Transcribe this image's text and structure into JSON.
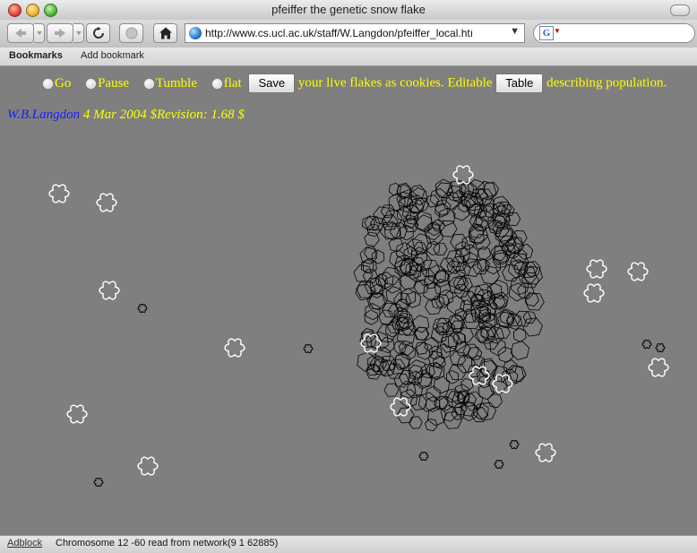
{
  "window": {
    "title": "pfeiffer the genetic snow flake"
  },
  "toolbar": {
    "url": "http://www.cs.ucl.ac.uk/staff/W.Langdon/pfeiffer_local.htı",
    "search_value": ""
  },
  "bookmarks_bar": {
    "bookmarks_label": "Bookmarks",
    "add_bookmark_label": "Add bookmark"
  },
  "controls": {
    "go_label": "Go",
    "pause_label": "Pause",
    "tumble_label": "Tumble",
    "flat_label": "flat",
    "save_button": "Save",
    "save_suffix": "your live flakes as cookies. Editable",
    "table_button": "Table",
    "table_suffix": "describing population."
  },
  "byline": {
    "author": "W.B.Langdon",
    "date_revision": "4 Mar 2004 $Revision: 1.68 $"
  },
  "status": {
    "adblock_label": "Adblock",
    "message": "Chromosome 12 -60 read from network(9 1 62885)"
  },
  "colors": {
    "background": "#7f7f7f",
    "accent_text": "#ffff00",
    "link": "#1a1aff",
    "flake_outline_white": "#ffffff",
    "flake_outline_black": "#000000"
  }
}
